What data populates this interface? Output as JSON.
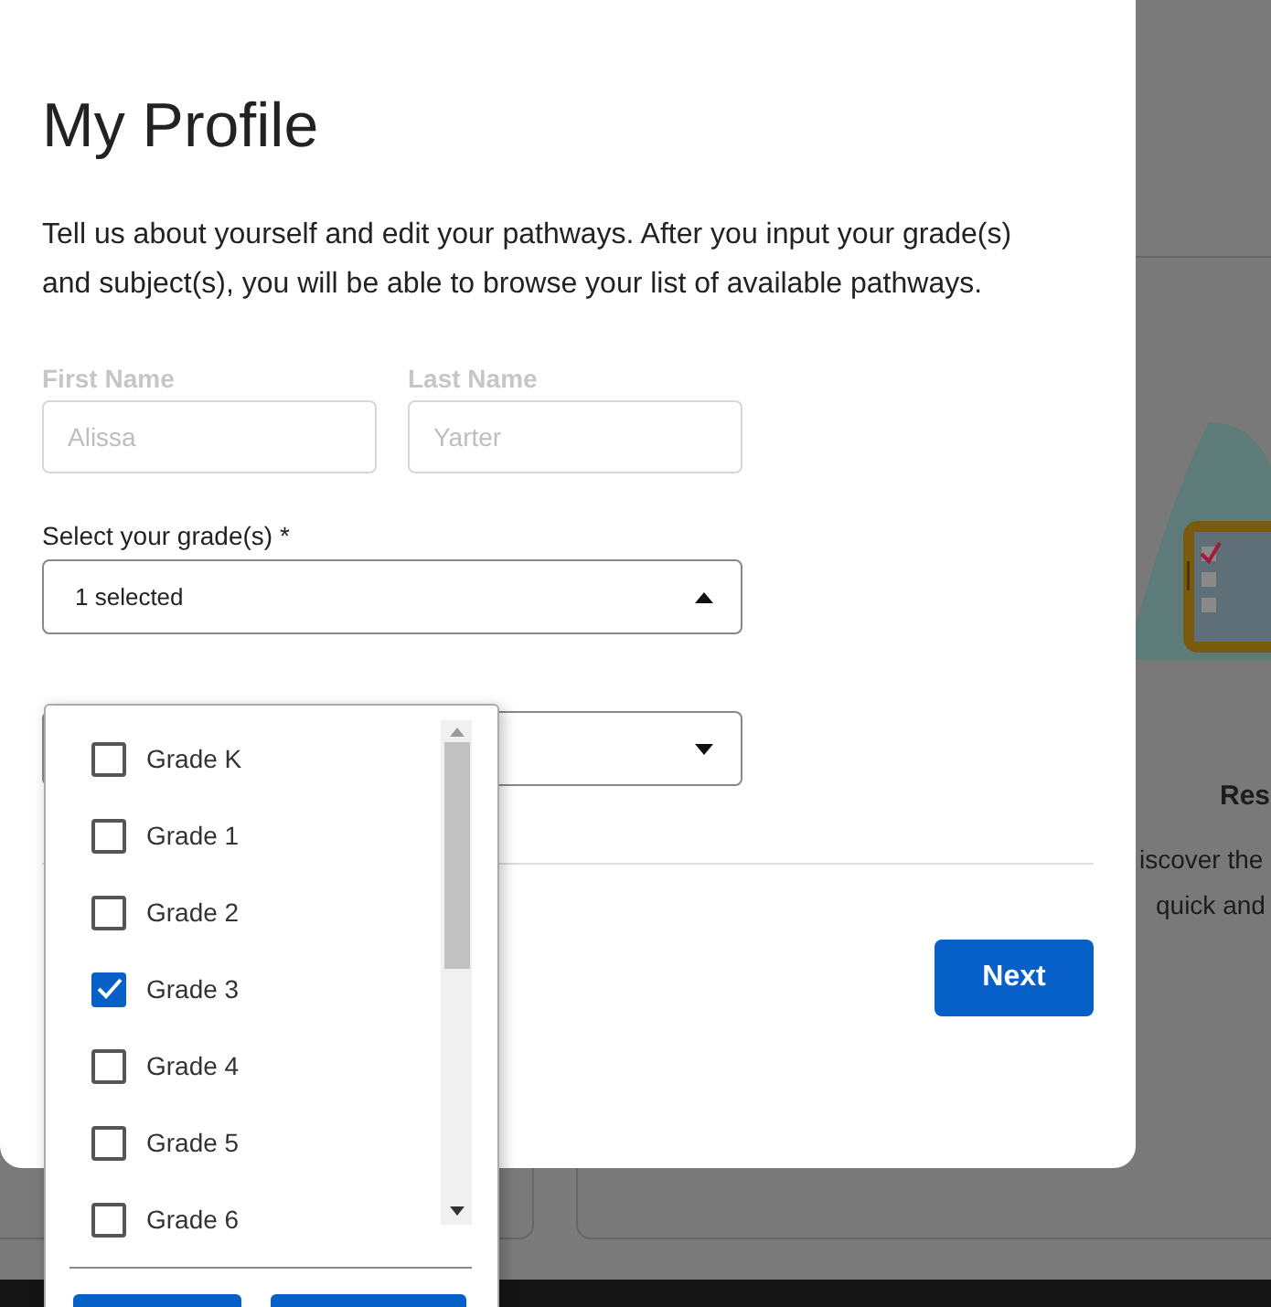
{
  "background_card": {
    "title": "Res",
    "lines": [
      "iscover the",
      "quick and"
    ]
  },
  "modal": {
    "title": "My Profile",
    "intro": "Tell us about yourself and edit your pathways. After you input your grade(s) and subject(s), you will be able to browse your list of available pathways.",
    "name_fields": [
      {
        "label": "First Name",
        "value": "Alissa",
        "disabled": true
      },
      {
        "label": "Last Name",
        "value": "Yarter",
        "disabled": true
      }
    ],
    "grade_select": {
      "label": "Select your grade(s) *",
      "value": "1 selected",
      "expanded": true
    },
    "second_select": {
      "expanded": false
    },
    "next_button": "Next"
  },
  "grade_options": [
    {
      "label": "Grade K",
      "checked": false
    },
    {
      "label": "Grade 1",
      "checked": false
    },
    {
      "label": "Grade 2",
      "checked": false
    },
    {
      "label": "Grade 3",
      "checked": true
    },
    {
      "label": "Grade 4",
      "checked": false
    },
    {
      "label": "Grade 5",
      "checked": false
    },
    {
      "label": "Grade 6",
      "checked": false
    }
  ]
}
